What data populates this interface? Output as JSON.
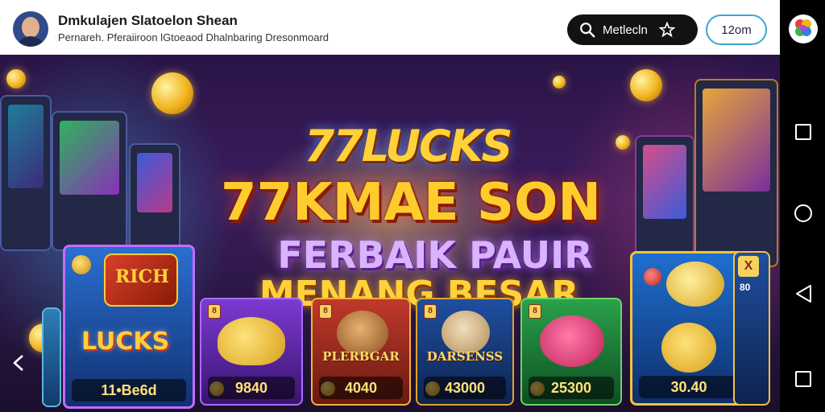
{
  "header": {
    "title": "Dmkulajen Slatoelon Shean",
    "subtitle": "Pernareh. Pferaiiroon lGtoeaod Dhalnbaring Dresonmoard",
    "search_label": "Metlecln",
    "pill_label": "12om"
  },
  "banner": {
    "logo": "77LUCKS",
    "headline": "77KMAE SON",
    "tagline": "FERBAIK PAUIR",
    "headline2": "MENANG BESAR"
  },
  "cards": [
    {
      "title": "LUCKS",
      "price": "11•Be6d",
      "tag": "RICH"
    },
    {
      "title": "",
      "price": "9840",
      "tag": "8"
    },
    {
      "title": "PLERBGAR",
      "price": "4040",
      "tag": "8"
    },
    {
      "title": "DARSENSS",
      "price": "43000",
      "tag": "8"
    },
    {
      "title": "",
      "price": "25300",
      "tag": "8"
    },
    {
      "title": "",
      "price": "30.40",
      "tag": "X"
    }
  ],
  "side_label": "80",
  "colors": {
    "accent": "#39a8d2",
    "gold": "#ffcc2e",
    "purple": "#d8b3ff",
    "banner_bg": "#2a1447"
  },
  "icons": {
    "search": "search-icon",
    "star": "star-icon",
    "nav_square": "recent-apps-icon",
    "nav_home": "home-icon",
    "nav_back": "back-icon"
  }
}
